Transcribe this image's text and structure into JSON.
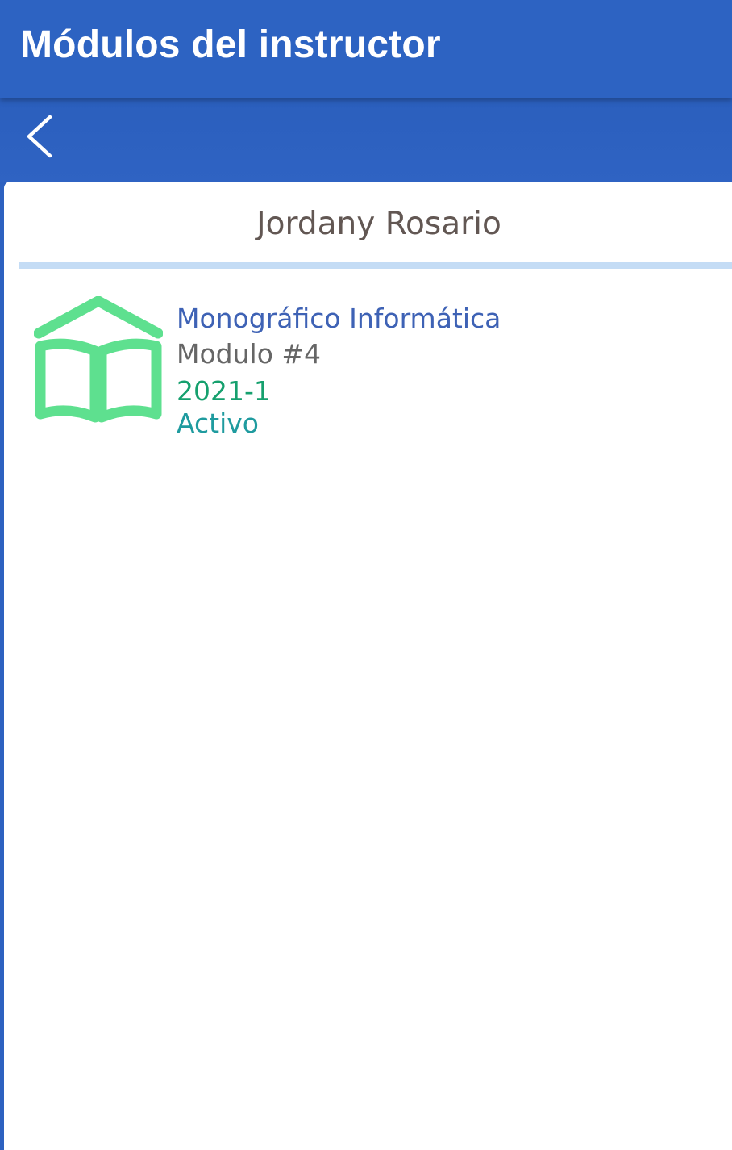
{
  "header": {
    "title": "Módulos del instructor"
  },
  "instructor": {
    "name": "Jordany Rosario"
  },
  "modules": [
    {
      "course": "Monográfico Informática",
      "module": "Modulo #4",
      "period": "2021-1",
      "status": "Activo",
      "icon": "book-house-icon"
    }
  ],
  "colors": {
    "primary": "#2d63c2",
    "divider": "#c4dcf5",
    "icon_green": "#5ee08f",
    "course_text": "#3e62b5",
    "period_text": "#16a06e",
    "status_text": "#1f9b9f"
  }
}
